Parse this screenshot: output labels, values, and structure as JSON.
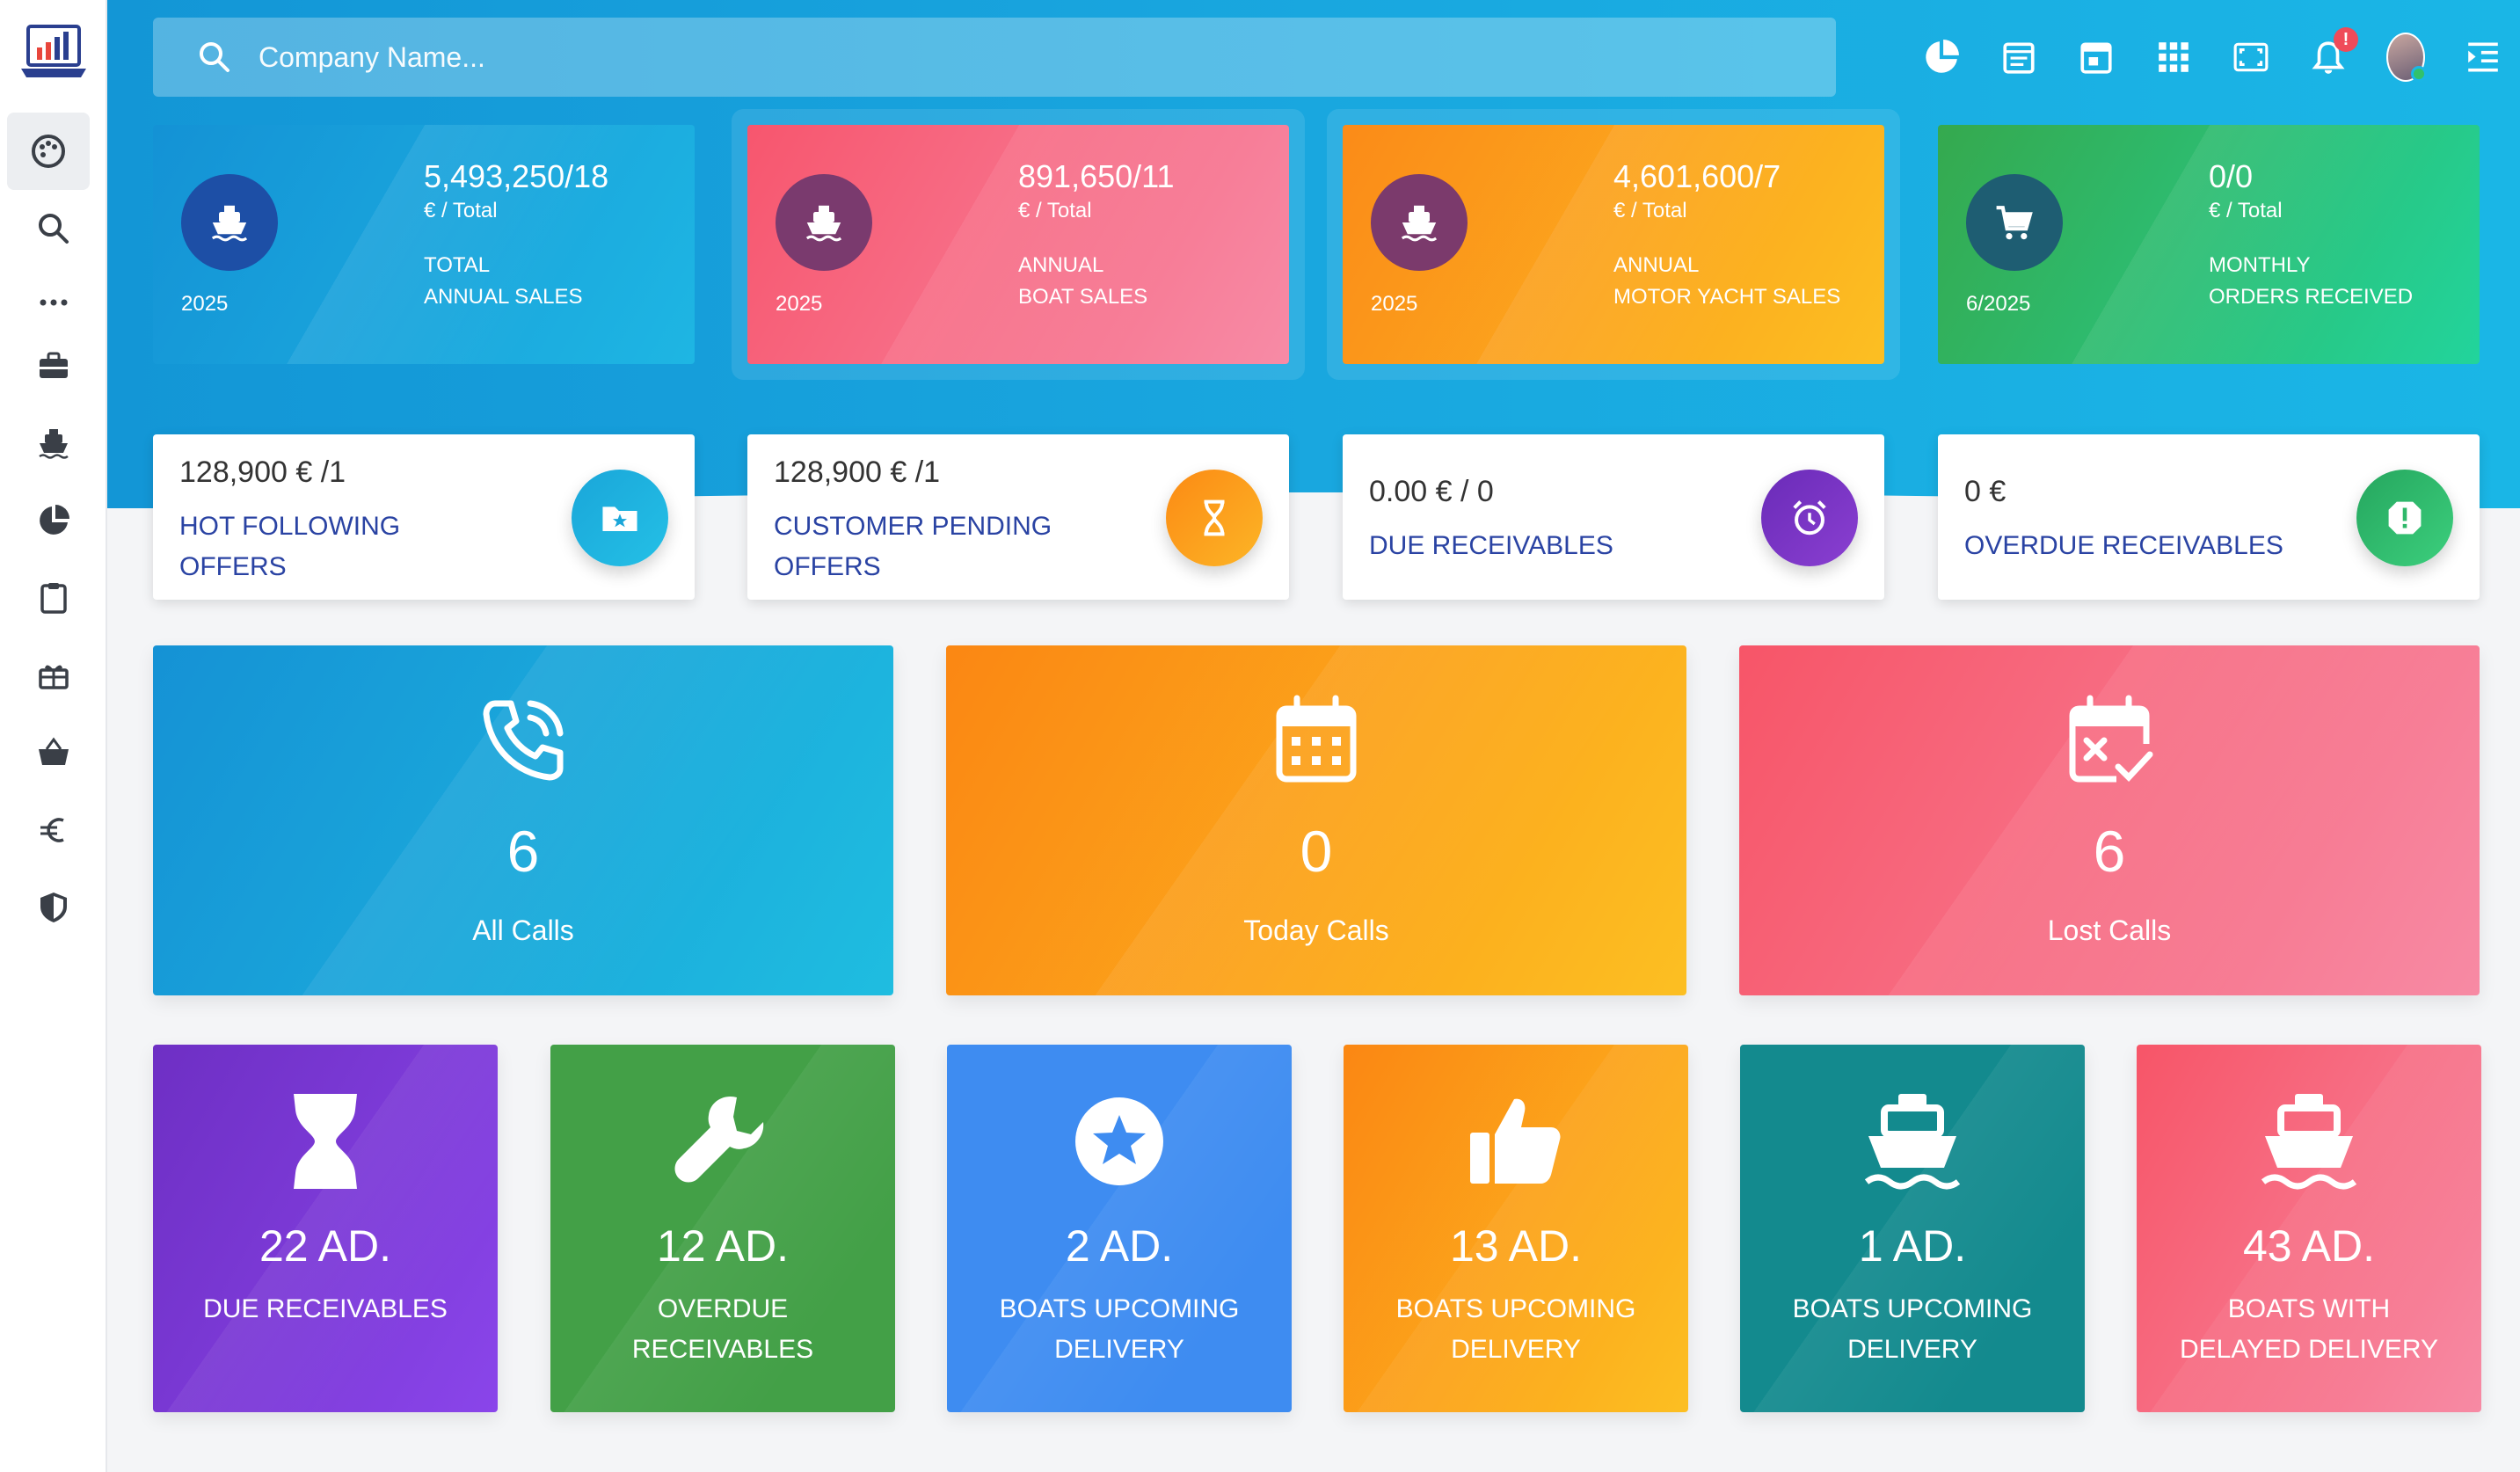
{
  "search": {
    "placeholder": "Company Name..."
  },
  "notifications": {
    "badge": "!"
  },
  "stats": [
    {
      "value": "5,493,250/18",
      "unit": "€ / Total",
      "label_line1": "TOTAL",
      "label_line2": "ANNUAL SALES",
      "year": "2025",
      "icon": "ship-icon",
      "bg": "#16a8df",
      "circle": "#1d4fa6"
    },
    {
      "value": "891,650/11",
      "unit": "€ / Total",
      "label_line1": "ANNUAL",
      "label_line2": "BOAT SALES",
      "year": "2025",
      "icon": "ship-icon",
      "bg": "#f4617a",
      "circle": "#7a3a6e"
    },
    {
      "value": "4,601,600/7",
      "unit": "€ / Total",
      "label_line1": "ANNUAL",
      "label_line2": "MOTOR YACHT SALES",
      "year": "2025",
      "icon": "ship-icon",
      "bg": "#fb9d1b",
      "circle": "#7b3a6c"
    },
    {
      "value": "0/0",
      "unit": "€ / Total",
      "label_line1": "MONTHLY",
      "label_line2": "ORDERS RECEIVED",
      "year": "6/2025",
      "icon": "cart-icon",
      "bg": "#2fbf6e",
      "circle": "#1e5d72"
    }
  ],
  "info_cards": [
    {
      "value": "128,900 € /1",
      "label_line1": "HOT FOLLOWING",
      "label_line2": "OFFERS",
      "icon": "folder-star-icon",
      "color": "#1aa6d9"
    },
    {
      "value": "128,900 € /1",
      "label_line1": "CUSTOMER PENDING",
      "label_line2": "OFFERS",
      "icon": "hourglass-icon",
      "color": "#fb9616"
    },
    {
      "value": "0.00 € / 0",
      "label_line1": "DUE RECEIVABLES",
      "label_line2": "",
      "icon": "alarm-clock-icon",
      "color": "#7a2fbf"
    },
    {
      "value": "0 €",
      "label_line1": "OVERDUE RECEIVABLES",
      "label_line2": "",
      "icon": "alert-icon",
      "color": "#2fb86a"
    }
  ],
  "calls": [
    {
      "value": "6",
      "label": "All Calls",
      "icon": "phone-call-icon"
    },
    {
      "value": "0",
      "label": "Today Calls",
      "icon": "calendar-icon"
    },
    {
      "value": "6",
      "label": "Lost Calls",
      "icon": "calendar-x-icon"
    }
  ],
  "tiles": [
    {
      "value": "22 AD.",
      "label_line1": "DUE RECEIVABLES",
      "label_line2": "",
      "icon": "hourglass-icon",
      "color": "#7b3fd6"
    },
    {
      "value": "12 AD.",
      "label_line1": "OVERDUE",
      "label_line2": "RECEIVABLES",
      "icon": "wrench-icon",
      "color": "#43a047"
    },
    {
      "value": "2 AD.",
      "label_line1": "BOATS UPCOMING",
      "label_line2": "DELIVERY",
      "icon": "star-icon",
      "color": "#3f8df2"
    },
    {
      "value": "13 AD.",
      "label_line1": "BOATS UPCOMING",
      "label_line2": "DELIVERY",
      "icon": "thumbs-up-icon",
      "color": "#fb9c1a"
    },
    {
      "value": "1 AD.",
      "label_line1": "BOATS UPCOMING",
      "label_line2": "DELIVERY",
      "icon": "ship-icon",
      "color": "#138a8e"
    },
    {
      "value": "43 AD.",
      "label_line1": "BOATS WITH",
      "label_line2": "DELAYED DELIVERY",
      "icon": "ship-icon",
      "color": "#f46079"
    }
  ]
}
